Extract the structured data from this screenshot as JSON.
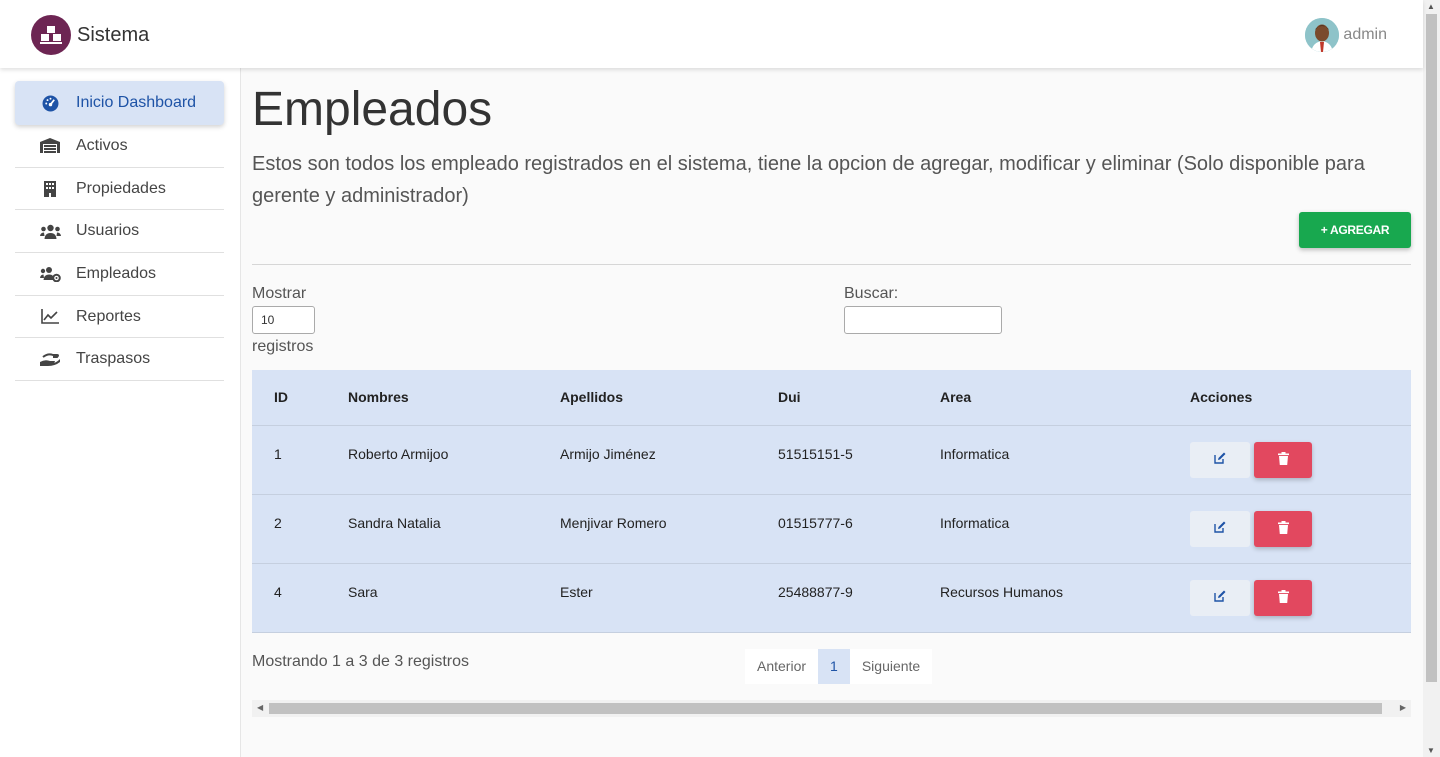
{
  "app": {
    "name": "Sistema",
    "user": "admin"
  },
  "sidebar": {
    "items": [
      {
        "label": "Inicio Dashboard",
        "icon": "dashboard-icon",
        "active": true
      },
      {
        "label": "Activos",
        "icon": "warehouse-icon"
      },
      {
        "label": "Propiedades",
        "icon": "building-icon"
      },
      {
        "label": "Usuarios",
        "icon": "users-icon"
      },
      {
        "label": "Empleados",
        "icon": "users-cog-icon"
      },
      {
        "label": "Reportes",
        "icon": "chart-line-icon"
      },
      {
        "label": "Traspasos",
        "icon": "hand-holding-icon"
      }
    ]
  },
  "main": {
    "title": "Empleados",
    "description": "Estos son todos los empleado registrados en el sistema, tiene la opcion de agregar, modificar y eliminar (Solo disponible para gerente y administrador)",
    "add_button": "+ AGREGAR",
    "length": {
      "label": "Mostrar",
      "value": "10",
      "suffix": "registros"
    },
    "search": {
      "label": "Buscar:",
      "value": ""
    },
    "table": {
      "headers": [
        "ID",
        "Nombres",
        "Apellidos",
        "Dui",
        "Area",
        "Acciones"
      ],
      "rows": [
        {
          "id": "1",
          "nombres": "Roberto Armijoo",
          "apellidos": "Armijo Jiménez",
          "dui": "51515151-5",
          "area": "Informatica"
        },
        {
          "id": "2",
          "nombres": "Sandra Natalia",
          "apellidos": "Menjivar Romero",
          "dui": "01515777-6",
          "area": "Informatica"
        },
        {
          "id": "4",
          "nombres": "Sara",
          "apellidos": "Ester",
          "dui": "25488877-9",
          "area": "Recursos Humanos"
        }
      ]
    },
    "info": "Mostrando 1 a 3 de 3 registros",
    "pagination": {
      "prev": "Anterior",
      "current": "1",
      "next": "Siguiente"
    }
  },
  "colors": {
    "brand": "#6d2553",
    "accent": "#1e53a6",
    "table_bg": "#d8e3f5",
    "add": "#18a84f",
    "delete": "#e2485f"
  }
}
